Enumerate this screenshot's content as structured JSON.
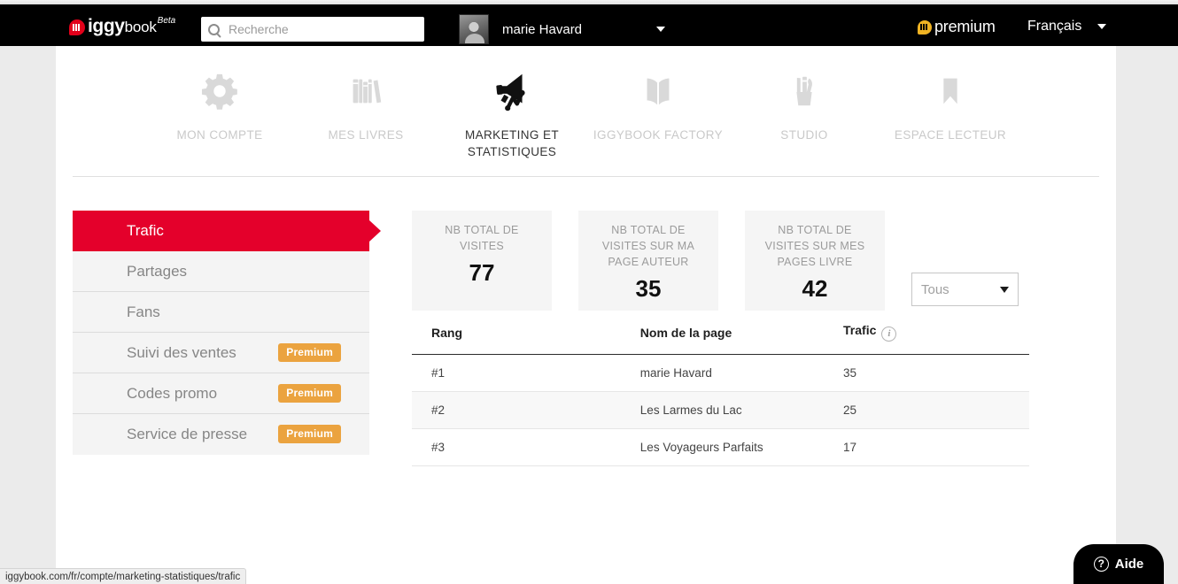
{
  "header": {
    "logo": {
      "name": "iggy",
      "suffix": "book",
      "beta": "Beta"
    },
    "search": {
      "placeholder": "Recherche",
      "value": ""
    },
    "user": {
      "name": "marie Havard"
    },
    "premium_label": "premium",
    "language": "Français"
  },
  "mainnav": [
    {
      "label": "MON COMPTE",
      "icon": "gear-icon",
      "active": false
    },
    {
      "label": "MES LIVRES",
      "icon": "books-icon",
      "active": false
    },
    {
      "label": "MARKETING ET STATISTIQUES",
      "icon": "megaphone-chart-icon",
      "active": true
    },
    {
      "label": "IGGYBOOK FACTORY",
      "icon": "open-book-icon",
      "active": false
    },
    {
      "label": "STUDIO",
      "icon": "pencil-cup-icon",
      "active": false
    },
    {
      "label": "ESPACE LECTEUR",
      "icon": "bookmark-icon",
      "active": false
    }
  ],
  "sidebar": {
    "items": [
      {
        "label": "Trafic",
        "active": true,
        "badge": null
      },
      {
        "label": "Partages",
        "active": false,
        "badge": null
      },
      {
        "label": "Fans",
        "active": false,
        "badge": null
      },
      {
        "label": "Suivi des ventes",
        "active": false,
        "badge": "Premium"
      },
      {
        "label": "Codes promo",
        "active": false,
        "badge": "Premium"
      },
      {
        "label": "Service de presse",
        "active": false,
        "badge": "Premium"
      }
    ]
  },
  "cards": [
    {
      "title": "NB TOTAL DE VISITES",
      "value": "77"
    },
    {
      "title": "NB TOTAL DE VISITES SUR MA PAGE AUTEUR",
      "value": "35"
    },
    {
      "title": "NB TOTAL DE VISITES SUR MES PAGES LIVRE",
      "value": "42"
    }
  ],
  "filter": {
    "value": "Tous",
    "options": [
      "Tous"
    ]
  },
  "table": {
    "columns": [
      "Rang",
      "Nom de la page",
      "Trafic"
    ],
    "rows": [
      {
        "rang": "#1",
        "nom": "marie Havard",
        "trafic": "35"
      },
      {
        "rang": "#2",
        "nom": "Les Larmes du Lac",
        "trafic": "25"
      },
      {
        "rang": "#3",
        "nom": "Les Voyageurs Parfaits",
        "trafic": "17"
      }
    ]
  },
  "help": {
    "label": "Aide",
    "glyph": "?"
  },
  "statusbar": {
    "url": "iggybook.com/fr/compte/marketing-statistiques/trafic"
  },
  "colors": {
    "accent_red": "#e4002b",
    "premium_orange": "#eba33f",
    "premium_gold": "#f0b323",
    "header_black": "#000000",
    "card_grey": "#f5f5f5"
  }
}
